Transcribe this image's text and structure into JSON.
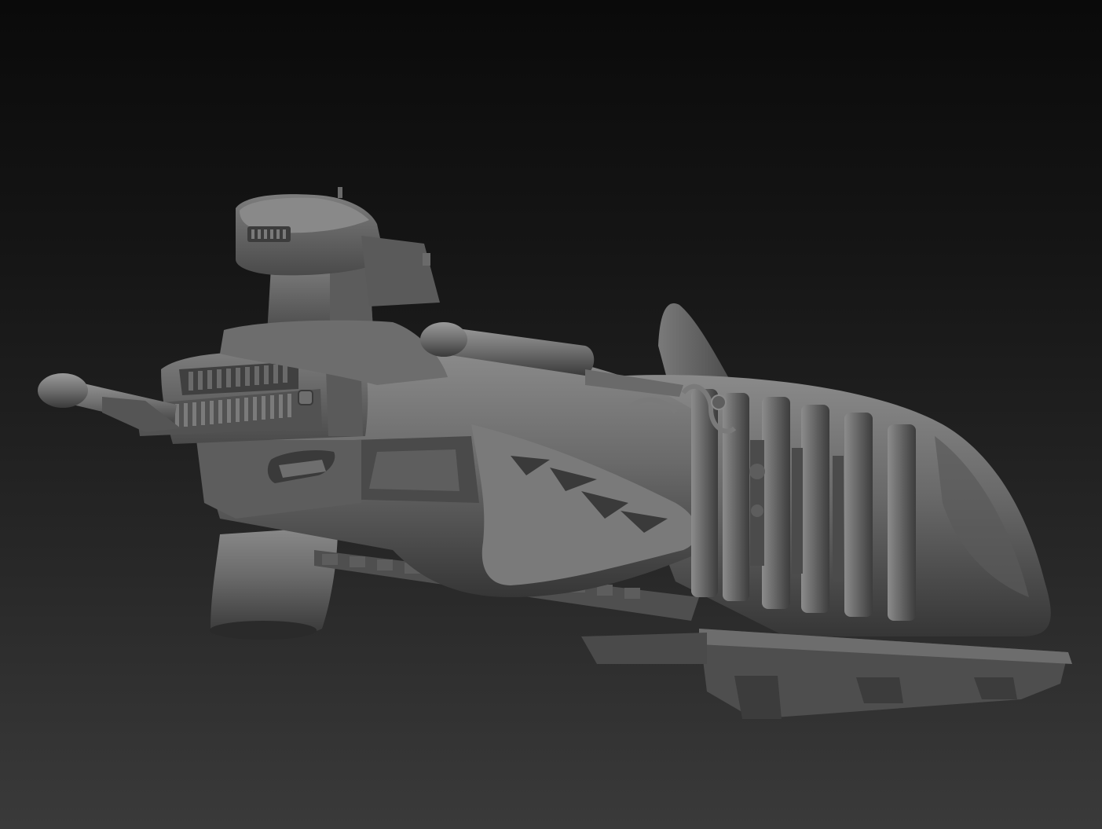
{
  "viewport": {
    "background_top": "#0a0a0a",
    "background_bottom": "#3a3a3a"
  },
  "model": {
    "material_base": "#6a6a6a",
    "material_light": "#8e8e8e",
    "material_shadow": "#2c2c2c"
  }
}
